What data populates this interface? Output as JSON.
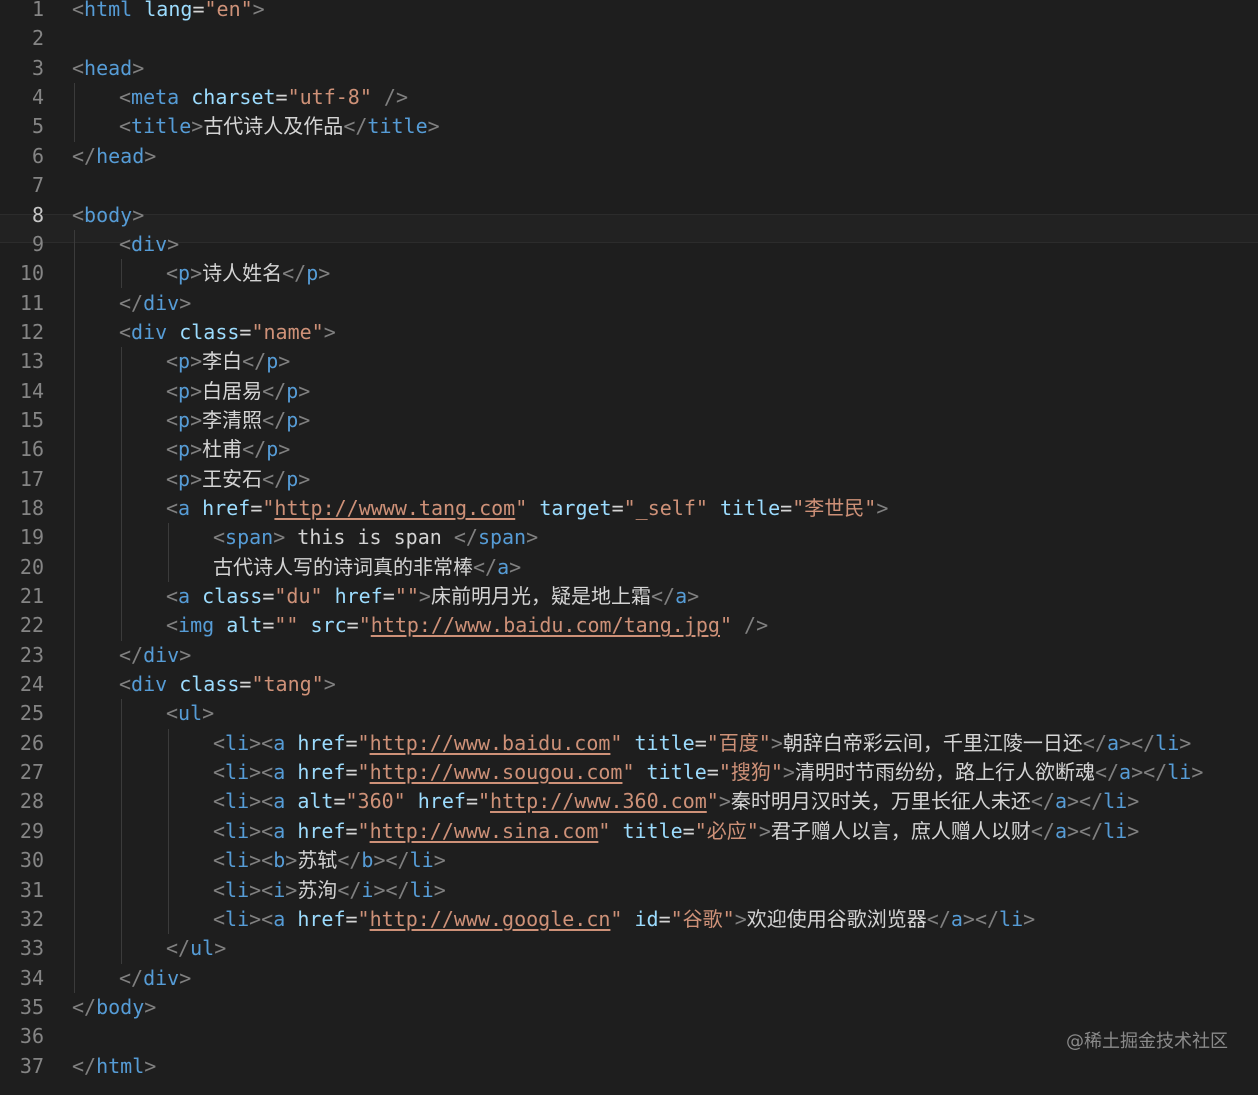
{
  "editor": {
    "colors": {
      "background": "#1e1e1e",
      "tag": "#569cd6",
      "attribute": "#9cdcfe",
      "string": "#ce9178",
      "punctuation": "#808080",
      "text": "#d4d4d4",
      "line_number": "#858585"
    },
    "current_line": 8,
    "lines": [
      {
        "n": "1",
        "indent": 0,
        "t": [
          [
            "p",
            "<"
          ],
          [
            "g",
            "html"
          ],
          [
            "a",
            " lang"
          ],
          [
            "x",
            "="
          ],
          [
            "v",
            "\"en\""
          ],
          [
            "p",
            ">"
          ]
        ]
      },
      {
        "n": "2",
        "indent": 0,
        "t": []
      },
      {
        "n": "3",
        "indent": 0,
        "t": [
          [
            "p",
            "<"
          ],
          [
            "g",
            "head"
          ],
          [
            "p",
            ">"
          ]
        ]
      },
      {
        "n": "4",
        "indent": 1,
        "t": [
          [
            "p",
            "<"
          ],
          [
            "g",
            "meta"
          ],
          [
            "a",
            " charset"
          ],
          [
            "x",
            "="
          ],
          [
            "v",
            "\"utf-8\""
          ],
          [
            "p",
            " />"
          ]
        ]
      },
      {
        "n": "5",
        "indent": 1,
        "t": [
          [
            "p",
            "<"
          ],
          [
            "g",
            "title"
          ],
          [
            "p",
            ">"
          ],
          [
            "x",
            "古代诗人及作品"
          ],
          [
            "p",
            "</"
          ],
          [
            "g",
            "title"
          ],
          [
            "p",
            ">"
          ]
        ]
      },
      {
        "n": "6",
        "indent": 0,
        "t": [
          [
            "p",
            "</"
          ],
          [
            "g",
            "head"
          ],
          [
            "p",
            ">"
          ]
        ]
      },
      {
        "n": "7",
        "indent": 0,
        "t": []
      },
      {
        "n": "8",
        "indent": 0,
        "t": [
          [
            "p",
            "<"
          ],
          [
            "g",
            "body"
          ],
          [
            "p",
            ">"
          ]
        ]
      },
      {
        "n": "9",
        "indent": 1,
        "t": [
          [
            "p",
            "<"
          ],
          [
            "g",
            "div"
          ],
          [
            "p",
            ">"
          ]
        ]
      },
      {
        "n": "10",
        "indent": 2,
        "t": [
          [
            "p",
            "<"
          ],
          [
            "g",
            "p"
          ],
          [
            "p",
            ">"
          ],
          [
            "x",
            "诗人姓名"
          ],
          [
            "p",
            "</"
          ],
          [
            "g",
            "p"
          ],
          [
            "p",
            ">"
          ]
        ]
      },
      {
        "n": "11",
        "indent": 1,
        "t": [
          [
            "p",
            "</"
          ],
          [
            "g",
            "div"
          ],
          [
            "p",
            ">"
          ]
        ]
      },
      {
        "n": "12",
        "indent": 1,
        "t": [
          [
            "p",
            "<"
          ],
          [
            "g",
            "div"
          ],
          [
            "a",
            " class"
          ],
          [
            "x",
            "="
          ],
          [
            "v",
            "\"name\""
          ],
          [
            "p",
            ">"
          ]
        ]
      },
      {
        "n": "13",
        "indent": 2,
        "t": [
          [
            "p",
            "<"
          ],
          [
            "g",
            "p"
          ],
          [
            "p",
            ">"
          ],
          [
            "x",
            "李白"
          ],
          [
            "p",
            "</"
          ],
          [
            "g",
            "p"
          ],
          [
            "p",
            ">"
          ]
        ]
      },
      {
        "n": "14",
        "indent": 2,
        "t": [
          [
            "p",
            "<"
          ],
          [
            "g",
            "p"
          ],
          [
            "p",
            ">"
          ],
          [
            "x",
            "白居易"
          ],
          [
            "p",
            "</"
          ],
          [
            "g",
            "p"
          ],
          [
            "p",
            ">"
          ]
        ]
      },
      {
        "n": "15",
        "indent": 2,
        "t": [
          [
            "p",
            "<"
          ],
          [
            "g",
            "p"
          ],
          [
            "p",
            ">"
          ],
          [
            "x",
            "李清照"
          ],
          [
            "p",
            "</"
          ],
          [
            "g",
            "p"
          ],
          [
            "p",
            ">"
          ]
        ]
      },
      {
        "n": "16",
        "indent": 2,
        "t": [
          [
            "p",
            "<"
          ],
          [
            "g",
            "p"
          ],
          [
            "p",
            ">"
          ],
          [
            "x",
            "杜甫"
          ],
          [
            "p",
            "</"
          ],
          [
            "g",
            "p"
          ],
          [
            "p",
            ">"
          ]
        ]
      },
      {
        "n": "17",
        "indent": 2,
        "t": [
          [
            "p",
            "<"
          ],
          [
            "g",
            "p"
          ],
          [
            "p",
            ">"
          ],
          [
            "x",
            "王安石"
          ],
          [
            "p",
            "</"
          ],
          [
            "g",
            "p"
          ],
          [
            "p",
            ">"
          ]
        ]
      },
      {
        "n": "18",
        "indent": 2,
        "t": [
          [
            "p",
            "<"
          ],
          [
            "g",
            "a"
          ],
          [
            "a",
            " href"
          ],
          [
            "x",
            "="
          ],
          [
            "v",
            "\""
          ],
          [
            "u",
            "http://wwww.tang.com"
          ],
          [
            "v",
            "\""
          ],
          [
            "a",
            " target"
          ],
          [
            "x",
            "="
          ],
          [
            "v",
            "\"_self\""
          ],
          [
            "a",
            " title"
          ],
          [
            "x",
            "="
          ],
          [
            "v",
            "\"李世民\""
          ],
          [
            "p",
            ">"
          ]
        ]
      },
      {
        "n": "19",
        "indent": 3,
        "t": [
          [
            "p",
            "<"
          ],
          [
            "g",
            "span"
          ],
          [
            "p",
            ">"
          ],
          [
            "x",
            " this is span "
          ],
          [
            "p",
            "</"
          ],
          [
            "g",
            "span"
          ],
          [
            "p",
            ">"
          ]
        ]
      },
      {
        "n": "20",
        "indent": 3,
        "t": [
          [
            "x",
            "古代诗人写的诗词真的非常棒"
          ],
          [
            "p",
            "</"
          ],
          [
            "g",
            "a"
          ],
          [
            "p",
            ">"
          ]
        ]
      },
      {
        "n": "21",
        "indent": 2,
        "t": [
          [
            "p",
            "<"
          ],
          [
            "g",
            "a"
          ],
          [
            "a",
            " class"
          ],
          [
            "x",
            "="
          ],
          [
            "v",
            "\"du\""
          ],
          [
            "a",
            " href"
          ],
          [
            "x",
            "="
          ],
          [
            "v",
            "\"\""
          ],
          [
            "p",
            ">"
          ],
          [
            "x",
            "床前明月光，疑是地上霜"
          ],
          [
            "p",
            "</"
          ],
          [
            "g",
            "a"
          ],
          [
            "p",
            ">"
          ]
        ]
      },
      {
        "n": "22",
        "indent": 2,
        "t": [
          [
            "p",
            "<"
          ],
          [
            "g",
            "img"
          ],
          [
            "a",
            " alt"
          ],
          [
            "x",
            "="
          ],
          [
            "v",
            "\"\""
          ],
          [
            "a",
            " src"
          ],
          [
            "x",
            "="
          ],
          [
            "v",
            "\""
          ],
          [
            "u",
            "http://www.baidu.com/tang.jpg"
          ],
          [
            "v",
            "\""
          ],
          [
            "p",
            " />"
          ]
        ]
      },
      {
        "n": "23",
        "indent": 1,
        "t": [
          [
            "p",
            "</"
          ],
          [
            "g",
            "div"
          ],
          [
            "p",
            ">"
          ]
        ]
      },
      {
        "n": "24",
        "indent": 1,
        "t": [
          [
            "p",
            "<"
          ],
          [
            "g",
            "div"
          ],
          [
            "a",
            " class"
          ],
          [
            "x",
            "="
          ],
          [
            "v",
            "\"tang\""
          ],
          [
            "p",
            ">"
          ]
        ]
      },
      {
        "n": "25",
        "indent": 2,
        "t": [
          [
            "p",
            "<"
          ],
          [
            "g",
            "ul"
          ],
          [
            "p",
            ">"
          ]
        ]
      },
      {
        "n": "26",
        "indent": 3,
        "t": [
          [
            "p",
            "<"
          ],
          [
            "g",
            "li"
          ],
          [
            "p",
            "><"
          ],
          [
            "g",
            "a"
          ],
          [
            "a",
            " href"
          ],
          [
            "x",
            "="
          ],
          [
            "v",
            "\""
          ],
          [
            "u",
            "http://www.baidu.com"
          ],
          [
            "v",
            "\""
          ],
          [
            "a",
            " title"
          ],
          [
            "x",
            "="
          ],
          [
            "v",
            "\"百度\""
          ],
          [
            "p",
            ">"
          ],
          [
            "x",
            "朝辞白帝彩云间，千里江陵一日还"
          ],
          [
            "p",
            "</"
          ],
          [
            "g",
            "a"
          ],
          [
            "p",
            "></"
          ],
          [
            "g",
            "li"
          ],
          [
            "p",
            ">"
          ]
        ]
      },
      {
        "n": "27",
        "indent": 3,
        "t": [
          [
            "p",
            "<"
          ],
          [
            "g",
            "li"
          ],
          [
            "p",
            "><"
          ],
          [
            "g",
            "a"
          ],
          [
            "a",
            " href"
          ],
          [
            "x",
            "="
          ],
          [
            "v",
            "\""
          ],
          [
            "u",
            "http://www.sougou.com"
          ],
          [
            "v",
            "\""
          ],
          [
            "a",
            " title"
          ],
          [
            "x",
            "="
          ],
          [
            "v",
            "\"搜狗\""
          ],
          [
            "p",
            ">"
          ],
          [
            "x",
            "清明时节雨纷纷，路上行人欲断魂"
          ],
          [
            "p",
            "</"
          ],
          [
            "g",
            "a"
          ],
          [
            "p",
            "></"
          ],
          [
            "g",
            "li"
          ],
          [
            "p",
            ">"
          ]
        ]
      },
      {
        "n": "28",
        "indent": 3,
        "t": [
          [
            "p",
            "<"
          ],
          [
            "g",
            "li"
          ],
          [
            "p",
            "><"
          ],
          [
            "g",
            "a"
          ],
          [
            "a",
            " alt"
          ],
          [
            "x",
            "="
          ],
          [
            "v",
            "\"360\""
          ],
          [
            "a",
            " href"
          ],
          [
            "x",
            "="
          ],
          [
            "v",
            "\""
          ],
          [
            "u",
            "http://www.360.com"
          ],
          [
            "v",
            "\""
          ],
          [
            "p",
            ">"
          ],
          [
            "x",
            "秦时明月汉时关，万里长征人未还"
          ],
          [
            "p",
            "</"
          ],
          [
            "g",
            "a"
          ],
          [
            "p",
            "></"
          ],
          [
            "g",
            "li"
          ],
          [
            "p",
            ">"
          ]
        ]
      },
      {
        "n": "29",
        "indent": 3,
        "t": [
          [
            "p",
            "<"
          ],
          [
            "g",
            "li"
          ],
          [
            "p",
            "><"
          ],
          [
            "g",
            "a"
          ],
          [
            "a",
            " href"
          ],
          [
            "x",
            "="
          ],
          [
            "v",
            "\""
          ],
          [
            "u",
            "http://www.sina.com"
          ],
          [
            "v",
            "\""
          ],
          [
            "a",
            " title"
          ],
          [
            "x",
            "="
          ],
          [
            "v",
            "\"必应\""
          ],
          [
            "p",
            ">"
          ],
          [
            "x",
            "君子赠人以言，庶人赠人以财"
          ],
          [
            "p",
            "</"
          ],
          [
            "g",
            "a"
          ],
          [
            "p",
            "></"
          ],
          [
            "g",
            "li"
          ],
          [
            "p",
            ">"
          ]
        ]
      },
      {
        "n": "30",
        "indent": 3,
        "t": [
          [
            "p",
            "<"
          ],
          [
            "g",
            "li"
          ],
          [
            "p",
            "><"
          ],
          [
            "g",
            "b"
          ],
          [
            "p",
            ">"
          ],
          [
            "x",
            "苏轼"
          ],
          [
            "p",
            "</"
          ],
          [
            "g",
            "b"
          ],
          [
            "p",
            "></"
          ],
          [
            "g",
            "li"
          ],
          [
            "p",
            ">"
          ]
        ]
      },
      {
        "n": "31",
        "indent": 3,
        "t": [
          [
            "p",
            "<"
          ],
          [
            "g",
            "li"
          ],
          [
            "p",
            "><"
          ],
          [
            "g",
            "i"
          ],
          [
            "p",
            ">"
          ],
          [
            "x",
            "苏洵"
          ],
          [
            "p",
            "</"
          ],
          [
            "g",
            "i"
          ],
          [
            "p",
            "></"
          ],
          [
            "g",
            "li"
          ],
          [
            "p",
            ">"
          ]
        ]
      },
      {
        "n": "32",
        "indent": 3,
        "t": [
          [
            "p",
            "<"
          ],
          [
            "g",
            "li"
          ],
          [
            "p",
            "><"
          ],
          [
            "g",
            "a"
          ],
          [
            "a",
            " href"
          ],
          [
            "x",
            "="
          ],
          [
            "v",
            "\""
          ],
          [
            "u",
            "http://www.google.cn"
          ],
          [
            "v",
            "\""
          ],
          [
            "a",
            " id"
          ],
          [
            "x",
            "="
          ],
          [
            "v",
            "\"谷歌\""
          ],
          [
            "p",
            ">"
          ],
          [
            "x",
            "欢迎使用谷歌浏览器"
          ],
          [
            "p",
            "</"
          ],
          [
            "g",
            "a"
          ],
          [
            "p",
            "></"
          ],
          [
            "g",
            "li"
          ],
          [
            "p",
            ">"
          ]
        ]
      },
      {
        "n": "33",
        "indent": 2,
        "t": [
          [
            "p",
            "</"
          ],
          [
            "g",
            "ul"
          ],
          [
            "p",
            ">"
          ]
        ]
      },
      {
        "n": "34",
        "indent": 1,
        "t": [
          [
            "p",
            "</"
          ],
          [
            "g",
            "div"
          ],
          [
            "p",
            ">"
          ]
        ]
      },
      {
        "n": "35",
        "indent": 0,
        "t": [
          [
            "p",
            "</"
          ],
          [
            "g",
            "body"
          ],
          [
            "p",
            ">"
          ]
        ]
      },
      {
        "n": "36",
        "indent": 0,
        "t": []
      },
      {
        "n": "37",
        "indent": 0,
        "t": [
          [
            "p",
            "</"
          ],
          [
            "g",
            "html"
          ],
          [
            "p",
            ">"
          ]
        ]
      }
    ]
  },
  "watermark": "@稀土掘金技术社区"
}
